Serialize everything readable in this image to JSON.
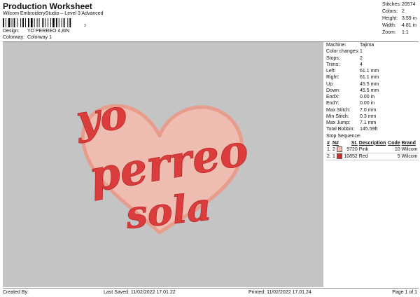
{
  "header": {
    "title": "Production Worksheet",
    "subtitle": "Wilcom EmbroideryStudio – Level 3 Advanced",
    "barcode_number": "3",
    "design_label": "Design:",
    "design_value": "YO PERREO 4,8IN",
    "colorway_label": "Colorway:",
    "colorway_value": "Colorway 1"
  },
  "stats": [
    {
      "label": "Stitches:",
      "value": "20574"
    },
    {
      "label": "Colors:",
      "value": "2"
    },
    {
      "label": "Height:",
      "value": "3.59 in"
    },
    {
      "label": "Width:",
      "value": "4.81 in"
    },
    {
      "label": "Zoom:",
      "value": "1:1"
    }
  ],
  "design": {
    "lines": [
      "yo",
      "perreo",
      "sola"
    ],
    "colors": {
      "background": "#c4c4c4",
      "heart_fill": "#f2c2b6",
      "heart_edge": "#e89c8c",
      "text": "#db3d3d"
    }
  },
  "specs": [
    {
      "label": "Machine:",
      "value": "Tajima"
    },
    {
      "label": "Color changes:",
      "value": "1"
    },
    {
      "label": "Stops:",
      "value": "2"
    },
    {
      "label": "Trims:",
      "value": "4"
    },
    {
      "label": "Left:",
      "value": "61.1 mm"
    },
    {
      "label": "Right:",
      "value": "61.1 mm"
    },
    {
      "label": "Up:",
      "value": "45.5 mm"
    },
    {
      "label": "Down:",
      "value": "45.5 mm"
    },
    {
      "label": "EndX:",
      "value": "0.00 in"
    },
    {
      "label": "EndY:",
      "value": "0.00 in"
    },
    {
      "label": "Max Stitch:",
      "value": "7.0 mm"
    },
    {
      "label": "Min Stitch:",
      "value": "0.3 mm"
    },
    {
      "label": "Max Jump:",
      "value": "7.1 mm"
    },
    {
      "label": "Total Bobbin:",
      "value": "145.59ft"
    }
  ],
  "stop_sequence": {
    "title": "Stop Sequence:",
    "columns": [
      "#",
      "N#",
      "St.",
      "Description",
      "Code",
      "Brand"
    ],
    "rows": [
      {
        "num": "1.",
        "needle": "2",
        "color": "#f2b8b0",
        "stitches": "9720",
        "description": "Pink",
        "code": "10",
        "brand": "Wilcom"
      },
      {
        "num": "2.",
        "needle": "1",
        "color": "#d42a2a",
        "stitches": "10852",
        "description": "Red",
        "code": "5",
        "brand": "Wilcom"
      }
    ]
  },
  "footer": {
    "created_by": "Created By:",
    "last_saved": "Last Saved: 11/02/2022 17.01.22",
    "printed": "Printed: 11/02/2022 17.01.24",
    "page": "Page 1 of 1"
  }
}
